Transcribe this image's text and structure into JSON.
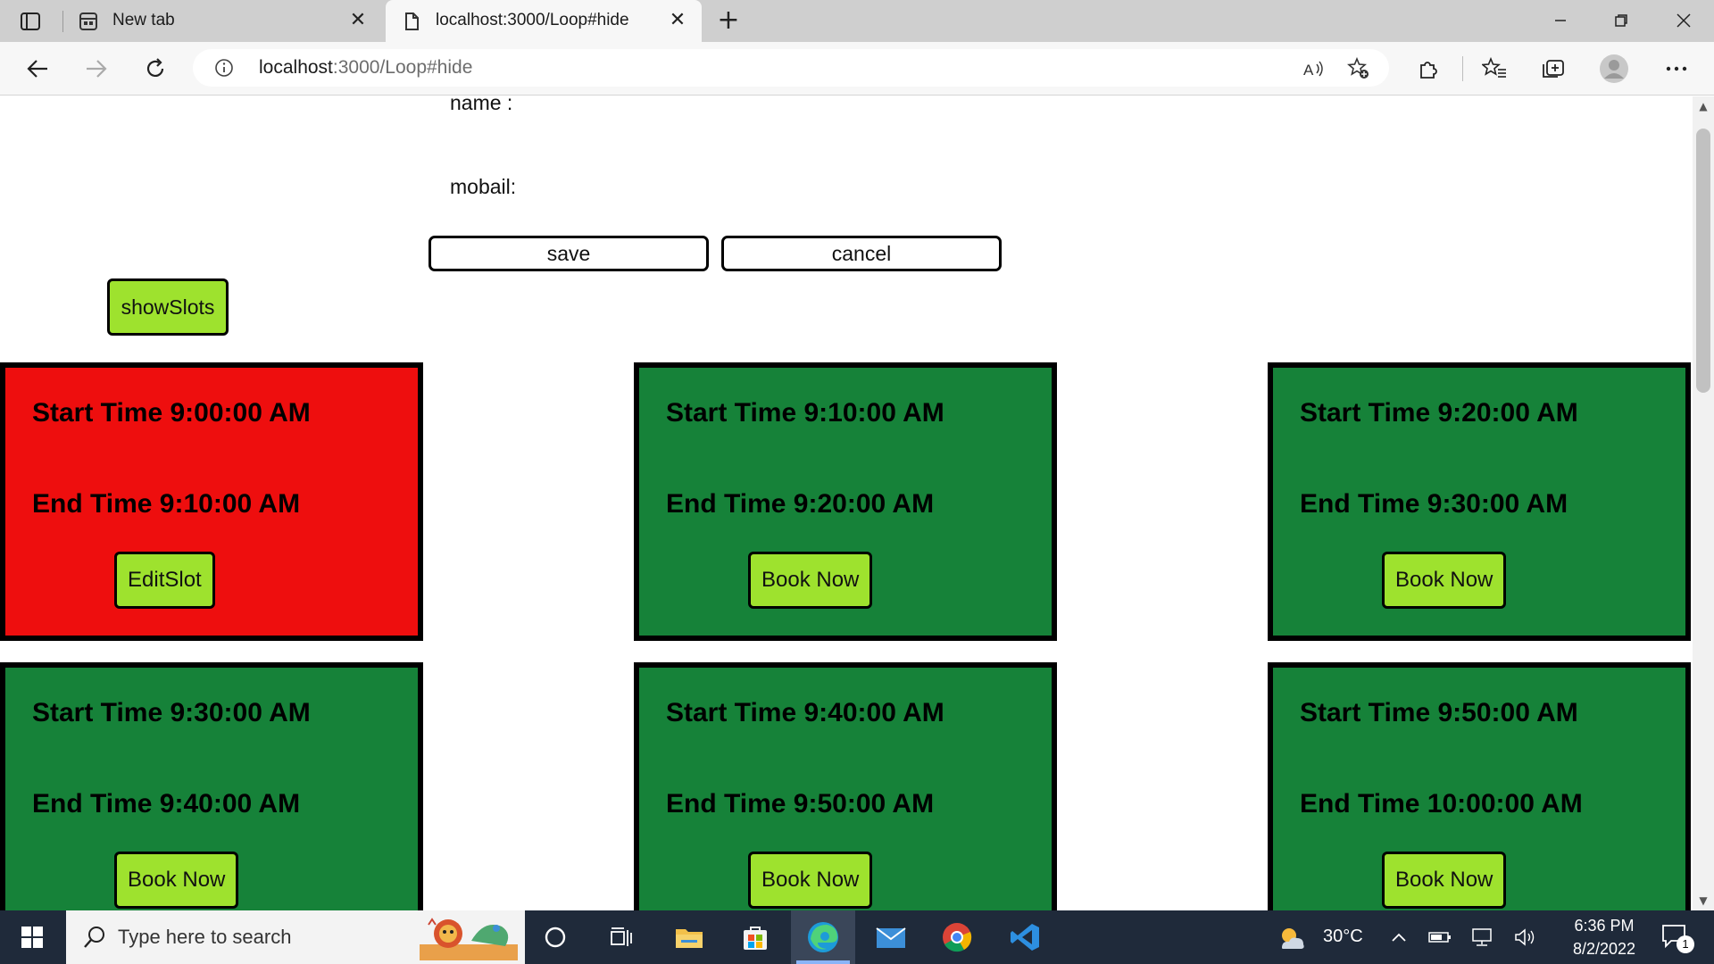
{
  "browser": {
    "tabs": [
      {
        "title": "New tab",
        "icon": "new-tab-page-icon",
        "active": false
      },
      {
        "title": "localhost:3000/Loop#hide",
        "icon": "page-icon",
        "active": true
      }
    ],
    "address": {
      "host": "localhost",
      "path": ":3000/Loop#hide"
    }
  },
  "form": {
    "name_label": "name :",
    "mobile_label": "mobail:",
    "save_label": "save",
    "cancel_label": "cancel"
  },
  "show_slots_label": "showSlots",
  "slots": [
    {
      "start": "Start Time 9:00:00 AM",
      "end": "End Time 9:10:00 AM",
      "action": "EditSlot",
      "status": "booked"
    },
    {
      "start": "Start Time 9:10:00 AM",
      "end": "End Time 9:20:00 AM",
      "action": "Book Now",
      "status": "free"
    },
    {
      "start": "Start Time 9:20:00 AM",
      "end": "End Time 9:30:00 AM",
      "action": "Book Now",
      "status": "free"
    },
    {
      "start": "Start Time 9:30:00 AM",
      "end": "End Time 9:40:00 AM",
      "action": "Book Now",
      "status": "free"
    },
    {
      "start": "Start Time 9:40:00 AM",
      "end": "End Time 9:50:00 AM",
      "action": "Book Now",
      "status": "free"
    },
    {
      "start": "Start Time 9:50:00 AM",
      "end": "End Time 10:00:00 AM",
      "action": "Book Now",
      "status": "free"
    }
  ],
  "colors": {
    "booked": "#ee0e0e",
    "free": "#168239",
    "button": "#9ee22e"
  },
  "taskbar": {
    "search_placeholder": "Type here to search",
    "temperature": "30°C",
    "time": "6:36 PM",
    "date": "8/2/2022",
    "notification_count": "1"
  }
}
